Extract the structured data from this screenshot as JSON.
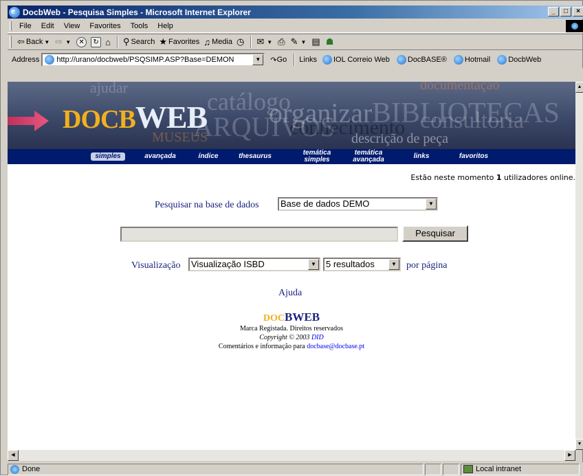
{
  "window": {
    "title": "DocbWeb - Pesquisa Simples - Microsoft Internet Explorer",
    "buttons": [
      "_",
      "□",
      "×"
    ]
  },
  "menu": [
    "File",
    "Edit",
    "View",
    "Favorites",
    "Tools",
    "Help"
  ],
  "toolbar": {
    "back": "Back",
    "search": "Search",
    "favorites": "Favorites",
    "media": "Media"
  },
  "address": {
    "label": "Address",
    "url": "http://urano/docbweb/PSQSIMP.ASP?Base=DEMON",
    "go": "Go",
    "links_label": "Links",
    "links": [
      "IOL Correio Web",
      "DocBASE®",
      "Hotmail",
      "DocbWeb"
    ]
  },
  "banner": {
    "brand_doc": "DOC",
    "brand_b": "B",
    "brand_web": "WEB",
    "background_words": [
      "ajudar",
      "catálogo",
      "organizar",
      "BIBLIOTECAS",
      "documentação",
      "ARQUIVOS",
      "consultoria",
      "conhecimento",
      "descrição de peça",
      "MUSEUS"
    ]
  },
  "nav": [
    {
      "label": "simples",
      "active": true
    },
    {
      "label": "avançada",
      "active": false
    },
    {
      "label": "índice",
      "active": false
    },
    {
      "label": "thesaurus",
      "active": false
    },
    {
      "label": "temática simples",
      "active": false
    },
    {
      "label": "temática avançada",
      "active": false
    },
    {
      "label": "links",
      "active": false
    },
    {
      "label": "favoritos",
      "active": false
    }
  ],
  "online": {
    "prefix": "Estão neste momento",
    "count": "1",
    "suffix": "utilizadores online."
  },
  "form": {
    "db_label": "Pesquisar na base de dados",
    "db_selected": "Base de dados DEMO",
    "search_value": "",
    "search_button": "Pesquisar",
    "view_label": "Visualização",
    "view_selected": "Visualização ISBD",
    "results_selected": "5 resultados",
    "per_page": "por página",
    "help": "Ajuda"
  },
  "footer": {
    "logo_doc": "DOC",
    "logo_b": "B",
    "logo_web": "WEB",
    "line1": "Marca Registada. Direitos reservados",
    "copyright_prefix": "Copyright © 2003",
    "copyright_owner": "DID",
    "contact_prefix": "Comentários e informação para",
    "contact_email": "docbase@docbase.pt"
  },
  "status": {
    "text": "Done",
    "zone": "Local intranet"
  }
}
